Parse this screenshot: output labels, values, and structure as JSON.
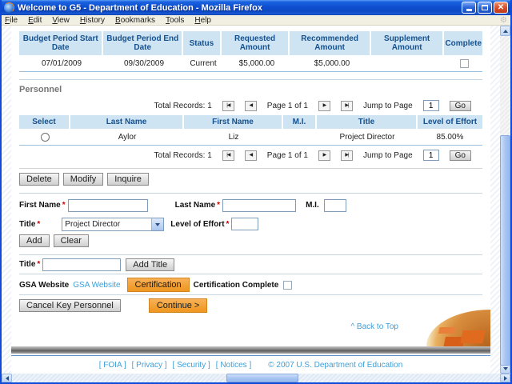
{
  "colors": {
    "accent_orange": "#F2A033",
    "table_header_blue": "#CFE4F3",
    "link_blue": "#3F9FD8",
    "header_text_blue": "#15518F",
    "titlebar_blue": "#0E4FD0"
  },
  "window": {
    "title": "Welcome to G5 - Department of Education - Mozilla Firefox"
  },
  "menu": {
    "items": [
      "File",
      "Edit",
      "View",
      "History",
      "Bookmarks",
      "Tools",
      "Help"
    ]
  },
  "budget_table": {
    "headers": [
      "Budget Period Start Date",
      "Budget Period End Date",
      "Status",
      "Requested Amount",
      "Recommended Amount",
      "Supplement Amount",
      "Complete"
    ],
    "row": {
      "start_date": "07/01/2009",
      "end_date": "09/30/2009",
      "status": "Current",
      "requested_amount": "$5,000.00",
      "recommended_amount": "$5,000.00",
      "supplement_amount": ""
    }
  },
  "personnel": {
    "section_label": "Personnel",
    "pager": {
      "total_label": "Total Records: 1",
      "first_icon": "|◀",
      "prev_icon": "◀",
      "page_label": "Page 1 of 1",
      "next_icon": "▶",
      "last_icon": "▶|",
      "jump_label": "Jump to Page",
      "jump_value": "1",
      "go_label": "Go"
    },
    "table": {
      "headers": [
        "Select",
        "Last Name",
        "First Name",
        "M.I.",
        "Title",
        "Level of Effort"
      ],
      "row": {
        "last_name": "Aylor",
        "first_name": "Liz",
        "mi": "",
        "title": "Project Director",
        "effort": "85.00%"
      }
    },
    "actions": {
      "delete": "Delete",
      "modify": "Modify",
      "inquire": "Inquire"
    }
  },
  "form": {
    "required_marker": "*",
    "first_name_label": "First Name",
    "last_name_label": "Last Name",
    "mi_label": "M.I.",
    "title_label": "Title",
    "title_value": "Project Director",
    "effort_label": "Level of Effort",
    "add_label": "Add",
    "clear_label": "Clear",
    "new_title_label": "Title",
    "add_title_label": "Add Title",
    "gsa_label": "GSA Website",
    "gsa_link": "GSA Website",
    "certification_label": "Certification",
    "cert_complete_label": "Certification Complete",
    "cancel_label": "Cancel Key Personnel",
    "continue_label": "Continue >"
  },
  "footer": {
    "back_to_top": "^ Back to Top",
    "links": [
      "[ FOIA ]",
      "[ Privacy ]",
      "[ Security ]",
      "[ Notices ]"
    ],
    "copyright": "©  2007  U.S.  Department  of  Education"
  }
}
